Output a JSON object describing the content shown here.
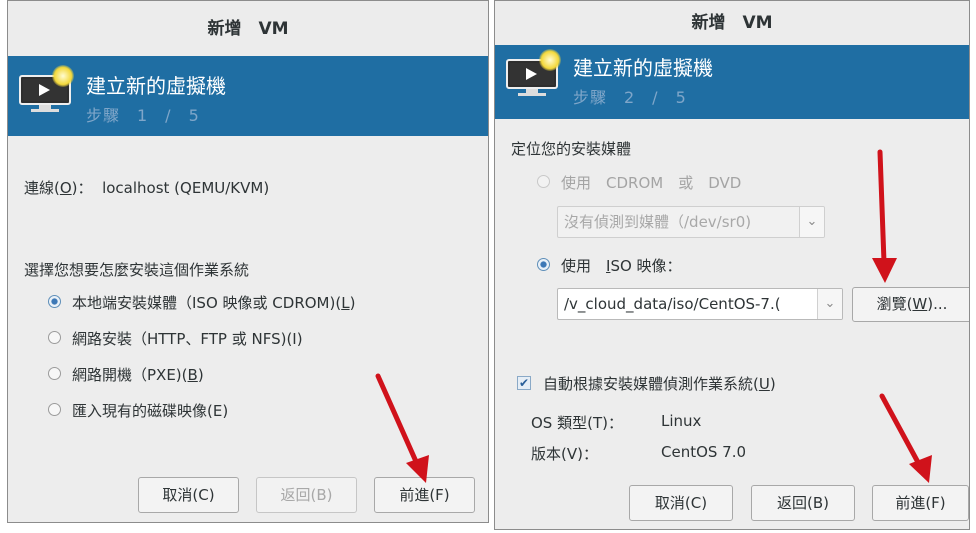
{
  "left": {
    "title": "新增　VM",
    "banner_title": "建立新的虛擬機",
    "banner_step": "步驟　1　/　5",
    "connection_label": "連線(",
    "connection_key": "O",
    "connection_tail": ")：",
    "connection_value": "localhost (QEMU/KVM)",
    "question": "選擇您想要怎麼安裝這個作業系統",
    "options": [
      {
        "label": "本地端安裝媒體（ISO 映像或 CDROM)(",
        "key": "L",
        "tail": ")"
      },
      {
        "label": "網路安裝（HTTP、FTP 或 NFS)(I)",
        "key": "",
        "tail": ""
      },
      {
        "label": "網路開機（PXE)(",
        "key": "B",
        "tail": ")"
      },
      {
        "label": "匯入現有的磁碟映像(E)",
        "key": "",
        "tail": ""
      }
    ],
    "buttons": {
      "cancel": "取消(C)",
      "back": "返回(B)",
      "forward": "前進(F)"
    }
  },
  "right": {
    "title": "新增　VM",
    "banner_title": "建立新的虛擬機",
    "banner_step": "步驟　2　/　5",
    "locate_label": "定位您的安裝媒體",
    "use_cdrom": "使用　CDROM　或　DVD",
    "cdrom_combo": "沒有偵測到媒體（/dev/sr0)",
    "use_iso_pre": "使用　",
    "use_iso_key": "I",
    "use_iso_post": "SO 映像：",
    "iso_path": "/v_cloud_data/iso/CentOS-7.(",
    "browse_pre": "瀏覽(",
    "browse_key": "W",
    "browse_post": ")...",
    "auto_detect_pre": "自動根據安裝媒體偵測作業系統(",
    "auto_detect_key": "U",
    "auto_detect_post": ")",
    "os_type_label": "OS 類型(T)：",
    "os_type_value": "Linux",
    "version_label": "版本(V)：",
    "version_value": "CentOS 7.0",
    "buttons": {
      "cancel": "取消(C)",
      "back": "返回(B)",
      "forward": "前進(F)"
    }
  },
  "colors": {
    "banner": "#1f6ea3",
    "arrow": "#d0121b",
    "selected_radio": "#3d78b6"
  }
}
